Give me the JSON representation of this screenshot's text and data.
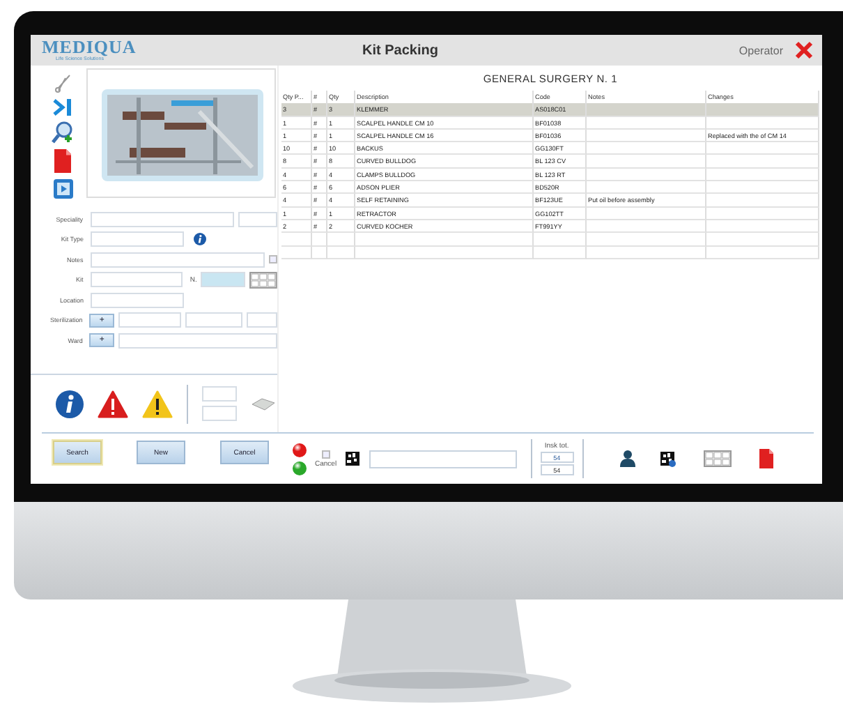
{
  "window": {
    "logo": "MEDIQUA",
    "tagline": "Life Science Solutions",
    "title": "Kit Packing",
    "user": "Operator"
  },
  "form": [
    {
      "kind": "pair",
      "label": "Speciality"
    },
    {
      "kind": "info",
      "label": "Kit Type"
    },
    {
      "kind": "check",
      "label": "Notes",
      "checked": false
    },
    {
      "kind": "number",
      "label": "Kit",
      "extra_label": "N."
    },
    {
      "kind": "short",
      "label": "Location"
    },
    {
      "kind": "add3",
      "label": "Sterilization",
      "button": "+"
    },
    {
      "kind": "add1",
      "label": "Ward",
      "button": "+"
    }
  ],
  "buttons": [
    {
      "label": "Search",
      "selected": true
    },
    {
      "label": "New",
      "selected": false
    },
    {
      "label": "Cancel",
      "selected": false
    }
  ],
  "table": {
    "heading": "GENERAL SURGERY N. 1",
    "columns": [
      "Qty P...",
      "#",
      "Qty",
      "Description",
      "Code",
      "Notes",
      "Changes"
    ],
    "rows": [
      {
        "selected": true,
        "cells": [
          "3",
          "#",
          "3",
          "KLEMMER",
          "AS018C01",
          "",
          ""
        ]
      },
      {
        "selected": false,
        "cells": [
          "1",
          "#",
          "1",
          "SCALPEL HANDLE CM 10",
          "BF01038",
          "",
          ""
        ]
      },
      {
        "selected": false,
        "cells": [
          "1",
          "#",
          "1",
          "SCALPEL HANDLE CM 16",
          "BF01036",
          "",
          "Replaced with the of CM 14"
        ]
      },
      {
        "selected": false,
        "cells": [
          "10",
          "#",
          "10",
          "BACKUS",
          "GG130FT",
          "",
          ""
        ]
      },
      {
        "selected": false,
        "cells": [
          "8",
          "#",
          "8",
          "CURVED BULLDOG",
          "BL 123 CV",
          "",
          ""
        ]
      },
      {
        "selected": false,
        "cells": [
          "4",
          "#",
          "4",
          "CLAMPS BULLDOG",
          "BL 123 RT",
          "",
          ""
        ]
      },
      {
        "selected": false,
        "cells": [
          "6",
          "#",
          "6",
          "ADSON PLIER",
          "BD520R",
          "",
          ""
        ]
      },
      {
        "selected": false,
        "cells": [
          "4",
          "#",
          "4",
          "SELF RETAINING",
          "BF123UE",
          "Put oil before assembly",
          ""
        ]
      },
      {
        "selected": false,
        "cells": [
          "1",
          "#",
          "1",
          "RETRACTOR",
          "GG102TT",
          "",
          ""
        ]
      },
      {
        "selected": false,
        "cells": [
          "2",
          "#",
          "2",
          "CURVED KOCHER",
          "FT991YY",
          "",
          ""
        ]
      }
    ]
  },
  "footer": {
    "cancel_label": "Cancel",
    "cancel_checked": false,
    "total_label": "Insk tot.",
    "totals": [
      "54",
      "54"
    ]
  }
}
